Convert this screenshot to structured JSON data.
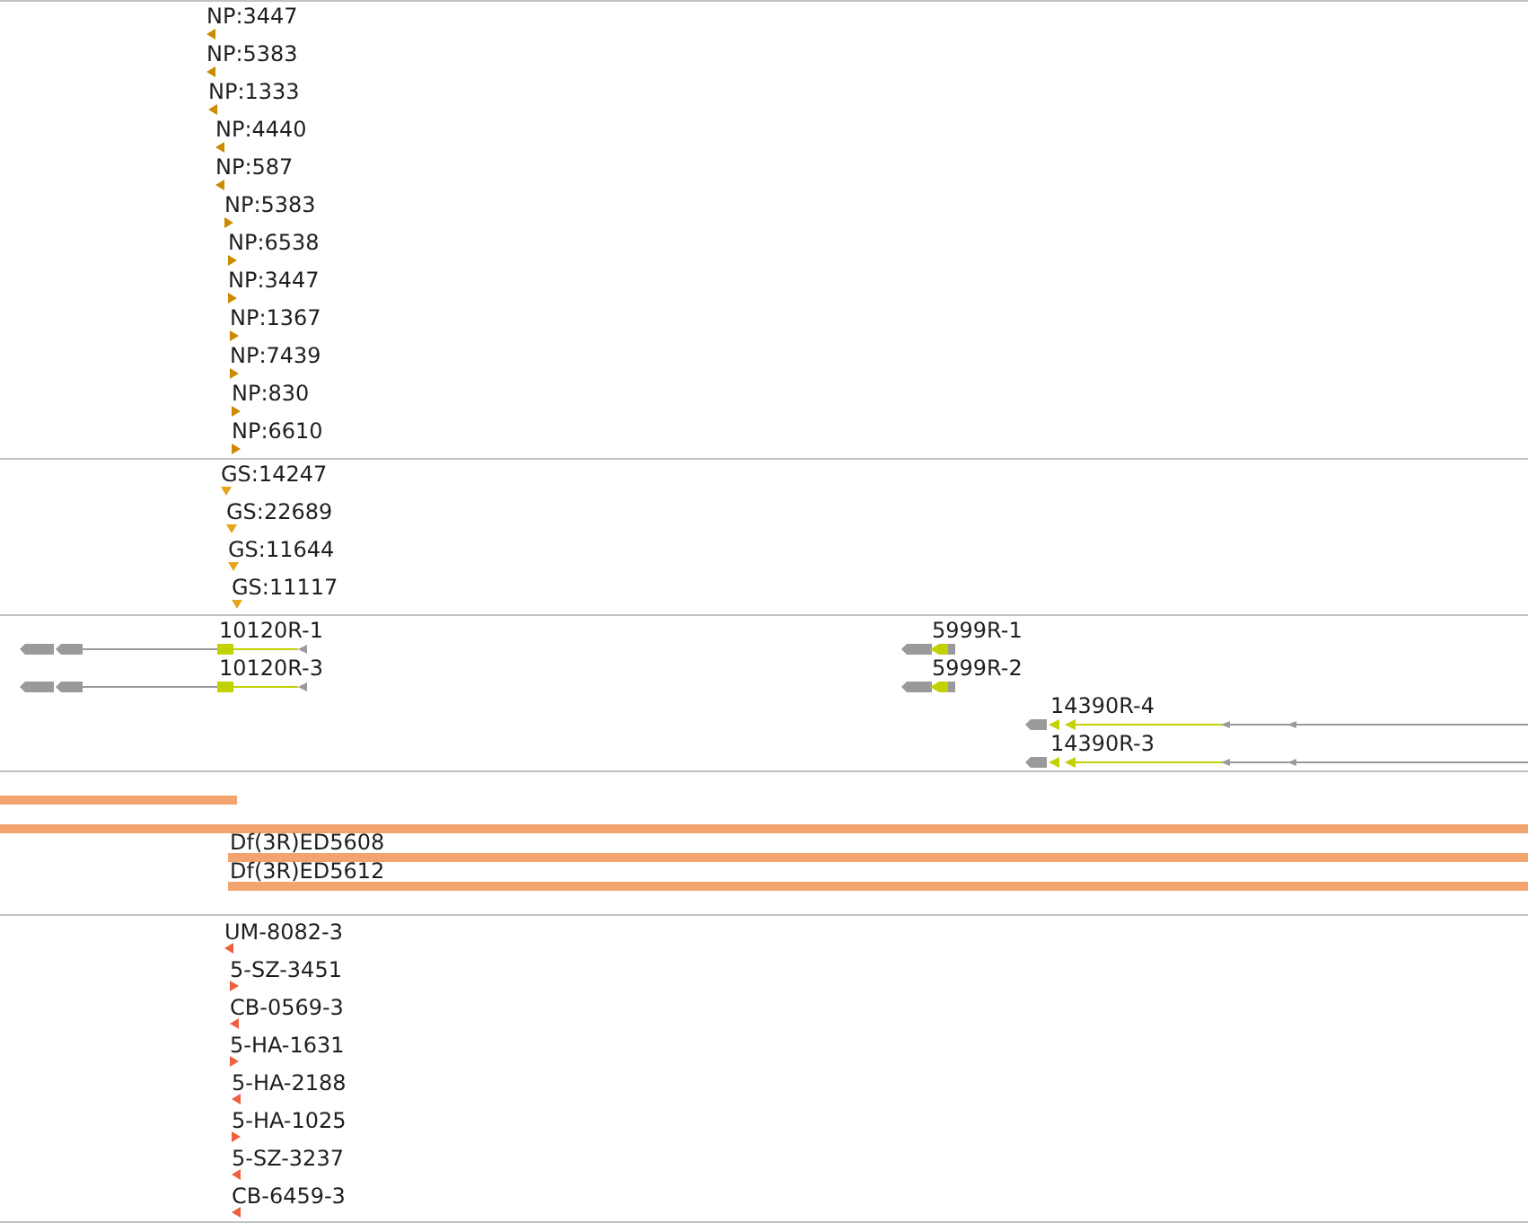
{
  "tracks": [
    {
      "kind": "stranded",
      "features": [
        {
          "label": "NP:3447",
          "reverse": true
        },
        {
          "label": "NP:5383",
          "reverse": true
        },
        {
          "label": "NP:1333",
          "reverse": true
        },
        {
          "label": "NP:4440",
          "reverse": true
        },
        {
          "label": "NP:587",
          "reverse": true
        },
        {
          "label": "NP:5383",
          "reverse": false
        },
        {
          "label": "NP:6538",
          "reverse": false
        },
        {
          "label": "NP:3447",
          "reverse": false
        },
        {
          "label": "NP:1367",
          "reverse": false
        },
        {
          "label": "NP:7439",
          "reverse": false
        },
        {
          "label": "NP:830",
          "reverse": false
        },
        {
          "label": "NP:6610",
          "reverse": false
        }
      ]
    },
    {
      "kind": "insertion",
      "features": [
        {
          "label": "GS:14247"
        },
        {
          "label": "GS:22689"
        },
        {
          "label": "GS:11644"
        },
        {
          "label": "GS:11117"
        }
      ]
    },
    {
      "kind": "transcript",
      "features": [
        {
          "label": "10120R-1"
        },
        {
          "label": "10120R-3"
        },
        {
          "label": "5999R-1"
        },
        {
          "label": "5999R-2"
        },
        {
          "label": "14390R-4"
        },
        {
          "label": "14390R-3"
        }
      ]
    },
    {
      "kind": "deficiency",
      "features": [
        {
          "clipped_left": true
        },
        {
          "clipped_left": true
        },
        {
          "label": "Df(3R)ED5608",
          "clipped_left": false
        },
        {
          "label": "Df(3R)ED5612",
          "clipped_left": false
        }
      ]
    },
    {
      "kind": "stranded",
      "features": [
        {
          "label": "UM-8082-3",
          "reverse": true
        },
        {
          "label": "5-SZ-3451",
          "reverse": false
        },
        {
          "label": "CB-0569-3",
          "reverse": true
        },
        {
          "label": "5-HA-1631",
          "reverse": false
        },
        {
          "label": "5-HA-2188",
          "reverse": true
        },
        {
          "label": "5-HA-1025",
          "reverse": false
        },
        {
          "label": "5-SZ-3237",
          "reverse": true
        },
        {
          "label": "CB-6459-3",
          "reverse": true
        }
      ]
    }
  ]
}
